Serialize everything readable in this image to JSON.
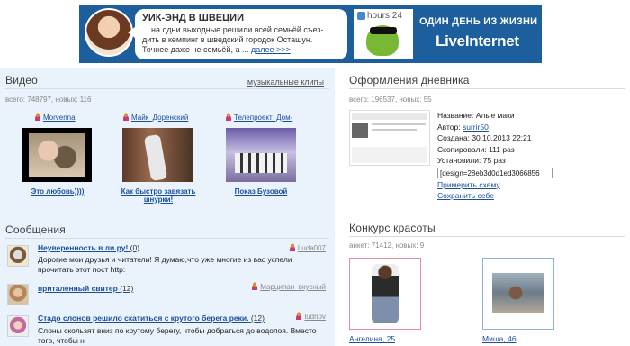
{
  "banner": {
    "title": "УИК-ЭНД В ШВЕЦИИ",
    "text": "... на одни выходные решили всей семьёй съез-дить в кемпинг в шведский городок Осташун. Точнее даже не семьёй, а ...",
    "more_link": "далее >>>",
    "tag": "hours 24",
    "slogan": "ОДИН ДЕНЬ ИЗ ЖИЗНИ",
    "logo": "LiveInternet"
  },
  "video": {
    "title": "Видео",
    "music_link": "музыкальные клипы",
    "stats": "всего: 748797, новых: 116",
    "items": [
      {
        "user": "Morvenna",
        "caption": "Это любовь))))"
      },
      {
        "user": "Майк_Доренский",
        "caption": "Как быстро завязать шнурки!"
      },
      {
        "user": "Телепроект_Дом-",
        "caption": "Показ Бузовой"
      }
    ]
  },
  "messages": {
    "title": "Сообщения",
    "items": [
      {
        "title": "Неуверенность в ли.ру!",
        "count": "(0)",
        "user": "Luda007",
        "text": "Дорогие мои друзья и читатели! Я думаю,что уже многие из вас успели прочитать этот пост http:"
      },
      {
        "title": "приталенный свитер",
        "count": "(12)",
        "user": "Марципан_вкусный",
        "text": ""
      },
      {
        "title": "Стадо слонов решило скатиться с крутого берега реки.",
        "count": "(12)",
        "user": "ludnov",
        "text": "Слоны скользят вниз по  крутому берегу, чтобы добраться до водопоя. Вместо того, чтобы н"
      }
    ]
  },
  "design": {
    "title": "Оформления дневника",
    "stats": "всего: 196537, новых: 55",
    "name_label": "Название:",
    "name": "Алые маки",
    "author_label": "Автор:",
    "author": "surrir50",
    "created_label": "Создана:",
    "created": "30.10.2013 22:21",
    "copied_label": "Скопировали:",
    "copied": "111 раз",
    "installed_label": "Установили:",
    "installed": "75 раз",
    "code": "[design=28eb3d0d1ed3066856",
    "apply_link": "Примерить схему",
    "save_link": "Сохранить себе"
  },
  "beauty": {
    "title": "Конкурс красоты",
    "stats": "анкет: 71412, новых: 9",
    "items": [
      {
        "name": "Ангелина",
        "score": "25"
      },
      {
        "name": "Миша",
        "score": "46"
      }
    ]
  }
}
